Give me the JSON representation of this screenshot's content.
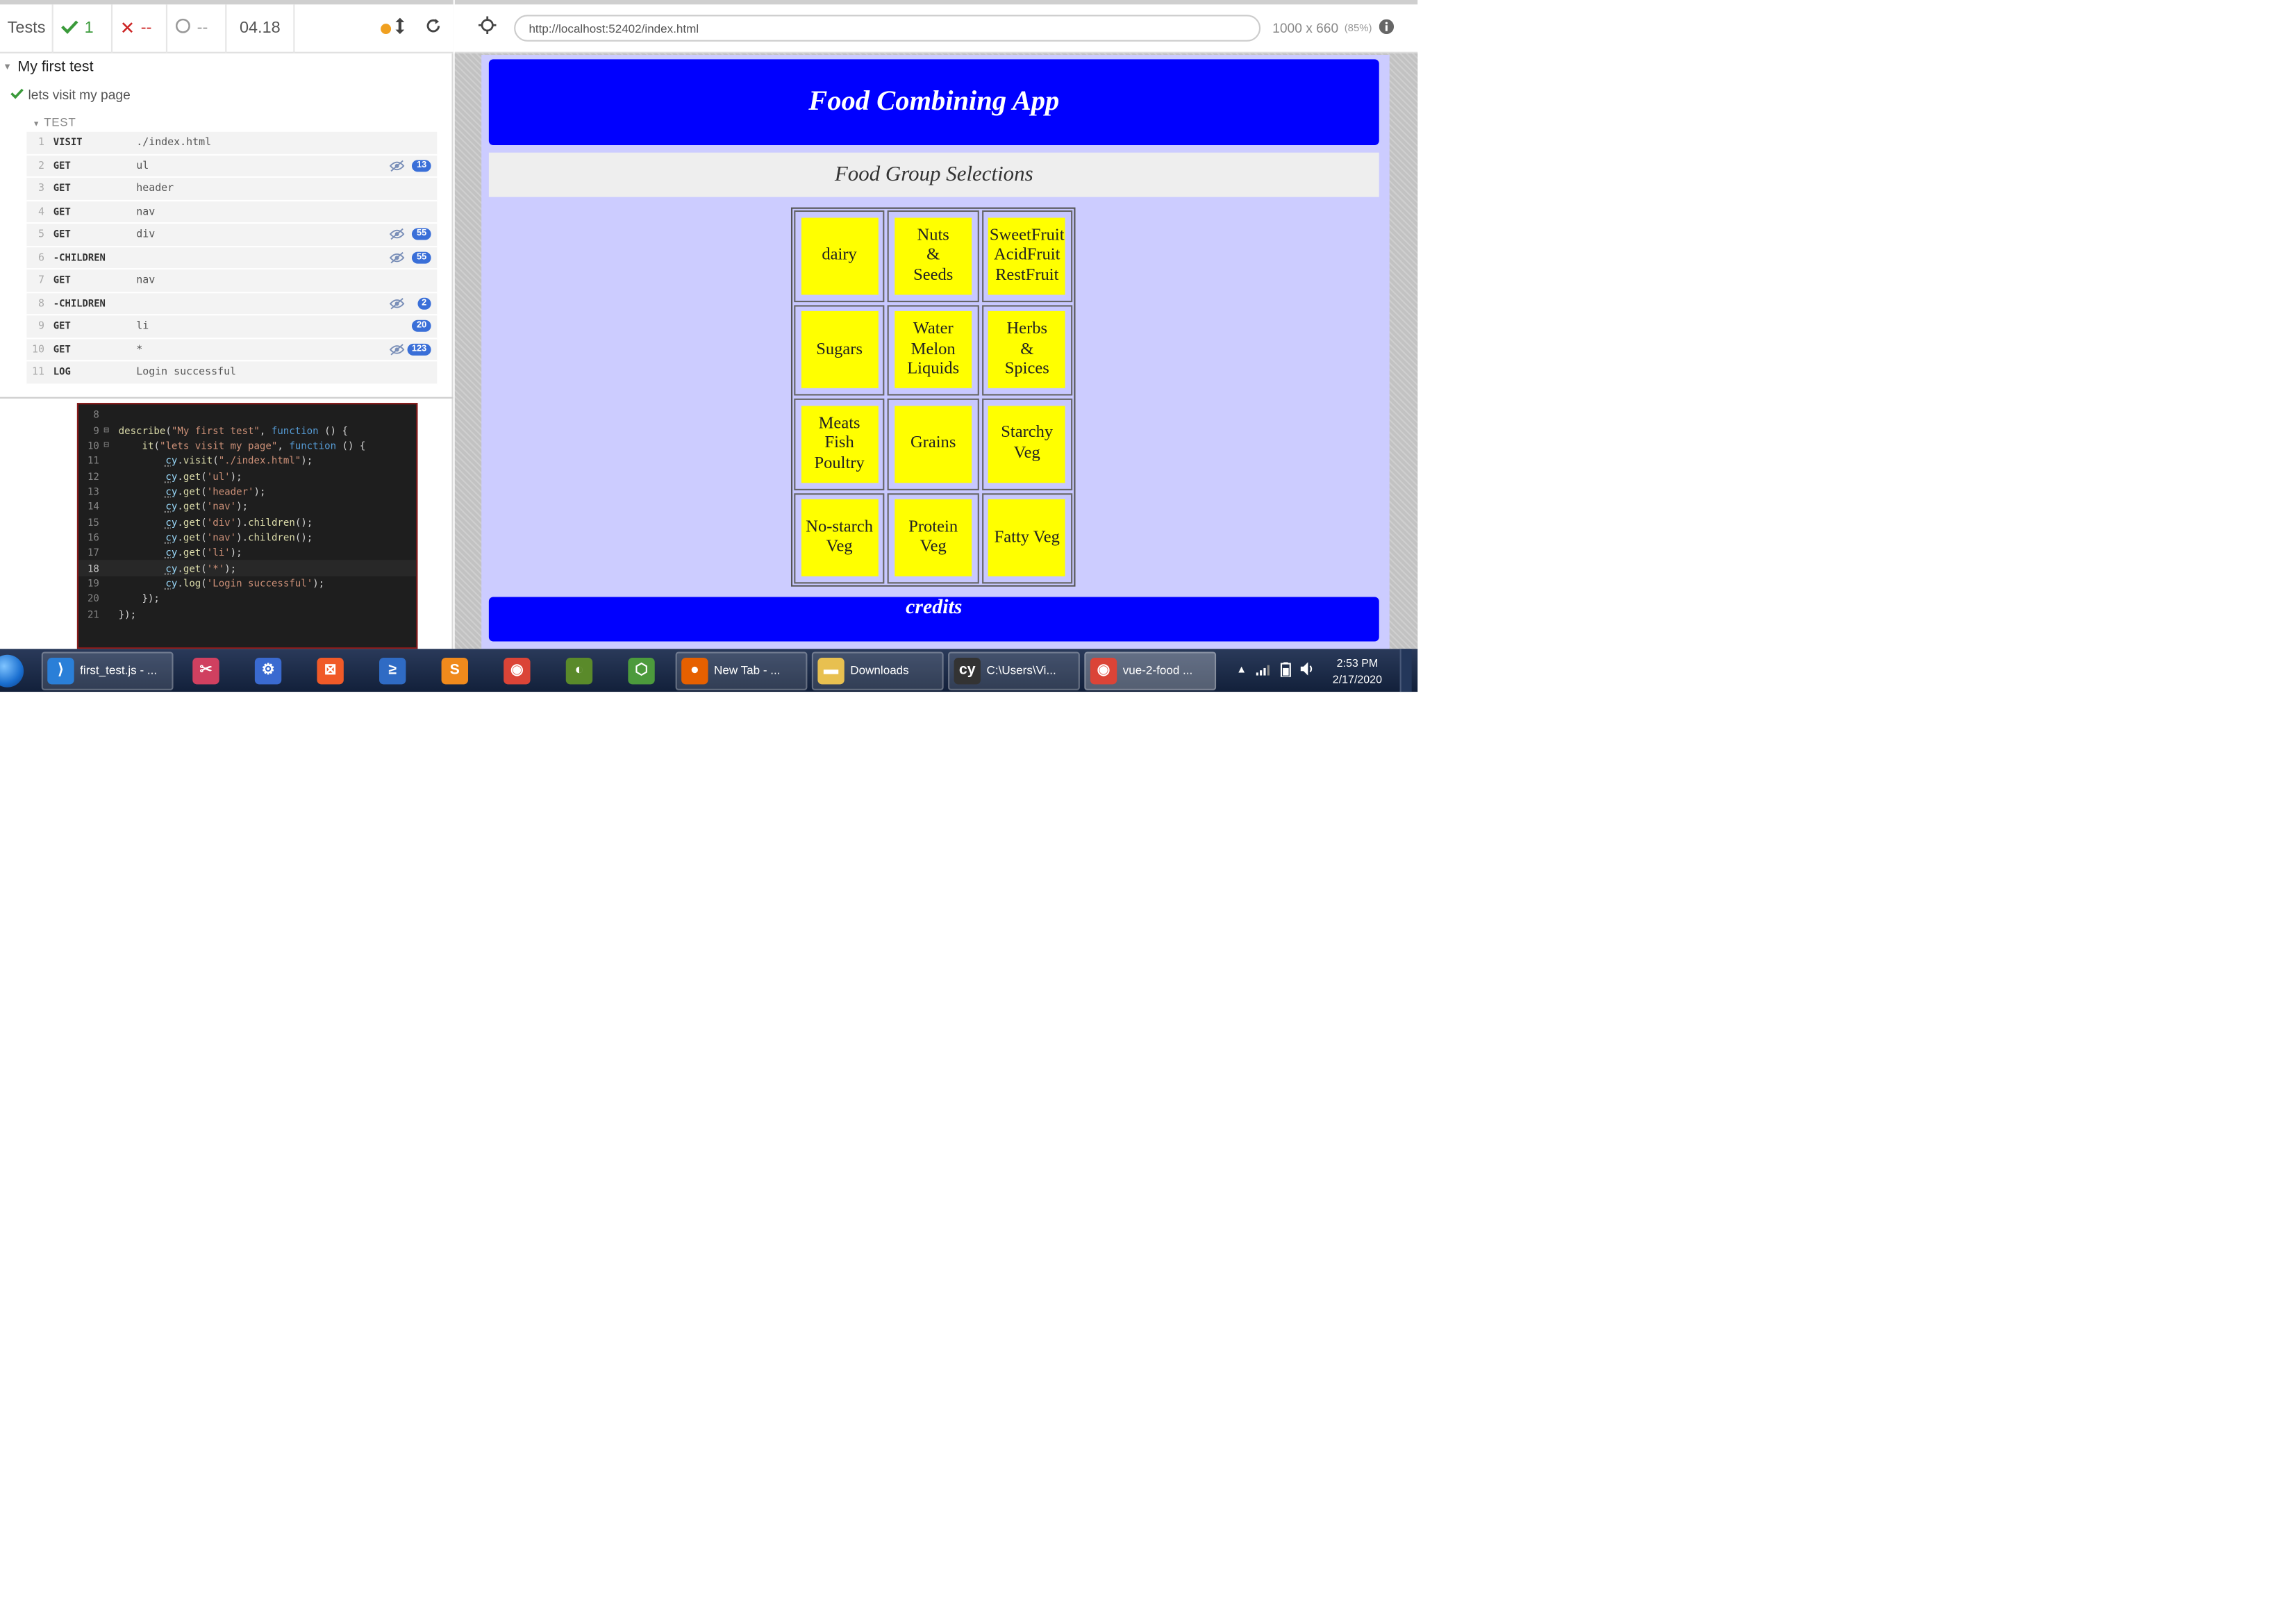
{
  "runner": {
    "tests_label": "Tests",
    "passed": "1",
    "failed": "--",
    "pending": "--",
    "duration": "04.18",
    "suite_title": "My first test",
    "test_title": "lets visit my page",
    "test_section": "TEST",
    "commands": [
      {
        "num": "1",
        "name": "VISIT",
        "msg": "./index.html",
        "badge": "",
        "hidden_icon": false
      },
      {
        "num": "2",
        "name": "GET",
        "msg": "ul",
        "badge": "13",
        "hidden_icon": true
      },
      {
        "num": "3",
        "name": "GET",
        "msg": "header",
        "badge": "",
        "hidden_icon": false
      },
      {
        "num": "4",
        "name": "GET",
        "msg": "nav",
        "badge": "",
        "hidden_icon": false
      },
      {
        "num": "5",
        "name": "GET",
        "msg": "div",
        "badge": "55",
        "hidden_icon": true
      },
      {
        "num": "6",
        "name": "-CHILDREN",
        "msg": "",
        "badge": "55",
        "hidden_icon": true
      },
      {
        "num": "7",
        "name": "GET",
        "msg": "nav",
        "badge": "",
        "hidden_icon": false
      },
      {
        "num": "8",
        "name": "-CHILDREN",
        "msg": "",
        "badge": "2",
        "hidden_icon": true
      },
      {
        "num": "9",
        "name": "GET",
        "msg": "li",
        "badge": "20",
        "hidden_icon": false
      },
      {
        "num": "10",
        "name": "GET",
        "msg": "*",
        "badge": "123",
        "hidden_icon": true
      },
      {
        "num": "11",
        "name": "LOG",
        "msg": "Login successful",
        "badge": "",
        "hidden_icon": false
      }
    ]
  },
  "code": {
    "lines": [
      {
        "n": "8",
        "fold": "",
        "text": ""
      },
      {
        "n": "9",
        "fold": "⊟",
        "text": "describe(\"My first test\", function () {"
      },
      {
        "n": "10",
        "fold": "⊟",
        "text": "    it(\"lets visit my page\", function () {"
      },
      {
        "n": "11",
        "fold": "",
        "text": "        cy.visit(\"./index.html\");"
      },
      {
        "n": "12",
        "fold": "",
        "text": "        cy.get('ul');"
      },
      {
        "n": "13",
        "fold": "",
        "text": "        cy.get('header');"
      },
      {
        "n": "14",
        "fold": "",
        "text": "        cy.get('nav');"
      },
      {
        "n": "15",
        "fold": "",
        "text": "        cy.get('div').children();"
      },
      {
        "n": "16",
        "fold": "",
        "text": "        cy.get('nav').children();"
      },
      {
        "n": "17",
        "fold": "",
        "text": "        cy.get('li');"
      },
      {
        "n": "18",
        "fold": "",
        "text": "        cy.get('*');"
      },
      {
        "n": "19",
        "fold": "",
        "text": "        cy.log('Login successful');"
      },
      {
        "n": "20",
        "fold": "",
        "text": "    });"
      },
      {
        "n": "21",
        "fold": "",
        "text": "});"
      }
    ],
    "active_line": "18"
  },
  "aut": {
    "url": "http://localhost:52402/index.html",
    "viewport": "1000 x 660",
    "scale": "(85%)"
  },
  "app": {
    "title": "Food Combining App",
    "subtitle": "Food Group Selections",
    "footer": "credits",
    "header_color": "#0000ff",
    "background_color": "#ccccff",
    "tile_color": "#ffff00",
    "groups": [
      "dairy",
      "Nuts\n&\nSeeds",
      "SweetFruit\nAcidFruit\nRestFruit",
      "Sugars",
      "Water\nMelon\nLiquids",
      "Herbs\n&\nSpices",
      "Meats\nFish\nPoultry",
      "Grains",
      "Starchy\nVeg",
      "No-starch\nVeg",
      "Protein\nVeg",
      "Fatty Veg"
    ]
  },
  "taskbar": {
    "items": [
      {
        "label": "first_test.js - ...",
        "icon": "vscode-icon",
        "color": "#2a7fd8",
        "glyph": "⟩",
        "wide": true
      },
      {
        "label": "",
        "icon": "snipping-tool-icon",
        "color": "#d04060",
        "glyph": "✂",
        "wide": false
      },
      {
        "label": "",
        "icon": "network-settings-icon",
        "color": "#3a6ad0",
        "glyph": "⚙",
        "wide": false
      },
      {
        "label": "",
        "icon": "xampp-icon",
        "color": "#f05a28",
        "glyph": "⊠",
        "wide": false
      },
      {
        "label": "",
        "icon": "powershell-icon",
        "color": "#2f6bc4",
        "glyph": "≥",
        "wide": false
      },
      {
        "label": "",
        "icon": "sublime-text-icon",
        "color": "#f08a1c",
        "glyph": "S",
        "wide": false
      },
      {
        "label": "",
        "icon": "chrome-icon",
        "color": "#db4437",
        "glyph": "◉",
        "wide": false
      },
      {
        "label": "",
        "icon": "nvidia-icon",
        "color": "#5a8a2a",
        "glyph": "◐",
        "wide": false
      },
      {
        "label": "",
        "icon": "nodejs-icon",
        "color": "#4c9a3c",
        "glyph": "⬡",
        "wide": false
      },
      {
        "label": "New Tab - ...",
        "icon": "firefox-icon",
        "color": "#e66000",
        "glyph": "●",
        "wide": true
      },
      {
        "label": "Downloads",
        "icon": "folder-icon",
        "color": "#e8c050",
        "glyph": "▬",
        "wide": true
      },
      {
        "label": "C:\\Users\\Vi...",
        "icon": "cypress-icon",
        "color": "#333333",
        "glyph": "cy",
        "wide": true
      },
      {
        "label": "vue-2-food ...",
        "icon": "chrome-icon",
        "color": "#db4437",
        "glyph": "◉",
        "wide": true,
        "active": true
      }
    ],
    "time": "2:53 PM",
    "date": "2/17/2020"
  }
}
